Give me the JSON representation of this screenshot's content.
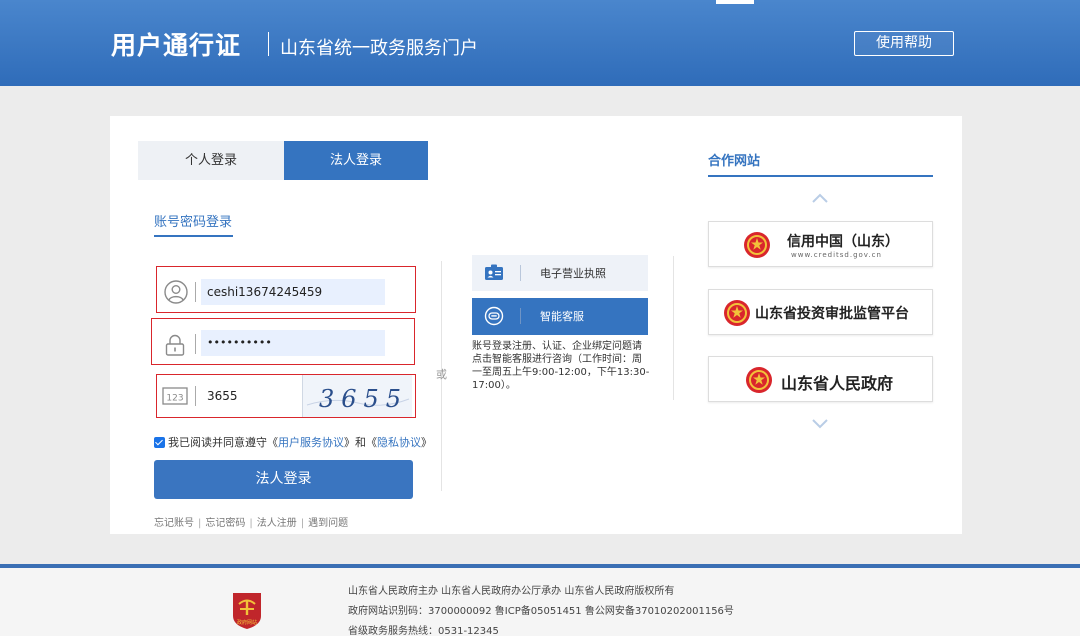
{
  "header": {
    "title": "用户通行证",
    "subtitle": "山东省统一政务服务门户",
    "help_label": "使用帮助"
  },
  "tabs": {
    "personal": "个人登录",
    "legal": "法人登录"
  },
  "login_mode": "账号密码登录",
  "form": {
    "username_value": "ceshi13674245459",
    "password_value": "••••••••••",
    "code_value": "3655",
    "captcha_text": "3655",
    "agree_prefix": "我已阅读并同意遵守",
    "agree_bracket_open": "《",
    "agree_bracket_close": "》",
    "agree_and": "和",
    "agree_link1": "用户服务协议",
    "agree_link2": "隐私协议",
    "submit_label": "法人登录"
  },
  "bottom_links": [
    "忘记账号",
    "忘记密码",
    "法人注册",
    "遇到问题"
  ],
  "or_text": "或",
  "alt_login": {
    "license_label": "电子营业执照",
    "service_label": "智能客服",
    "service_desc": "账号登录注册、认证、企业绑定问题请点击智能客服进行咨询（工作时间：周一至周五上午9:00-12:00，下午13:30-17:00）。"
  },
  "partners": {
    "title": "合作网站",
    "items": [
      {
        "name": "信用中国（山东）",
        "sub": "www.creditsd.gov.cn"
      },
      {
        "name": "山东省投资审批监管平台"
      },
      {
        "name": "山东省人民政府"
      }
    ]
  },
  "footer": {
    "logo_text": "政府网站",
    "line1": "山东省人民政府主办   山东省人民政府办公厅承办   山东省人民政府版权所有",
    "line2": "政府网站识别码：3700000092   鲁ICP备05051451   鲁公网安备37010202001156号",
    "line3": "省级政务服务热线：0531-12345"
  },
  "colors": {
    "primary": "#3574c0",
    "header_top": "#4a86cd",
    "header_bottom": "#2f6cb9",
    "highlight_border": "#d9262c",
    "input_bg": "#e8f0fe"
  }
}
